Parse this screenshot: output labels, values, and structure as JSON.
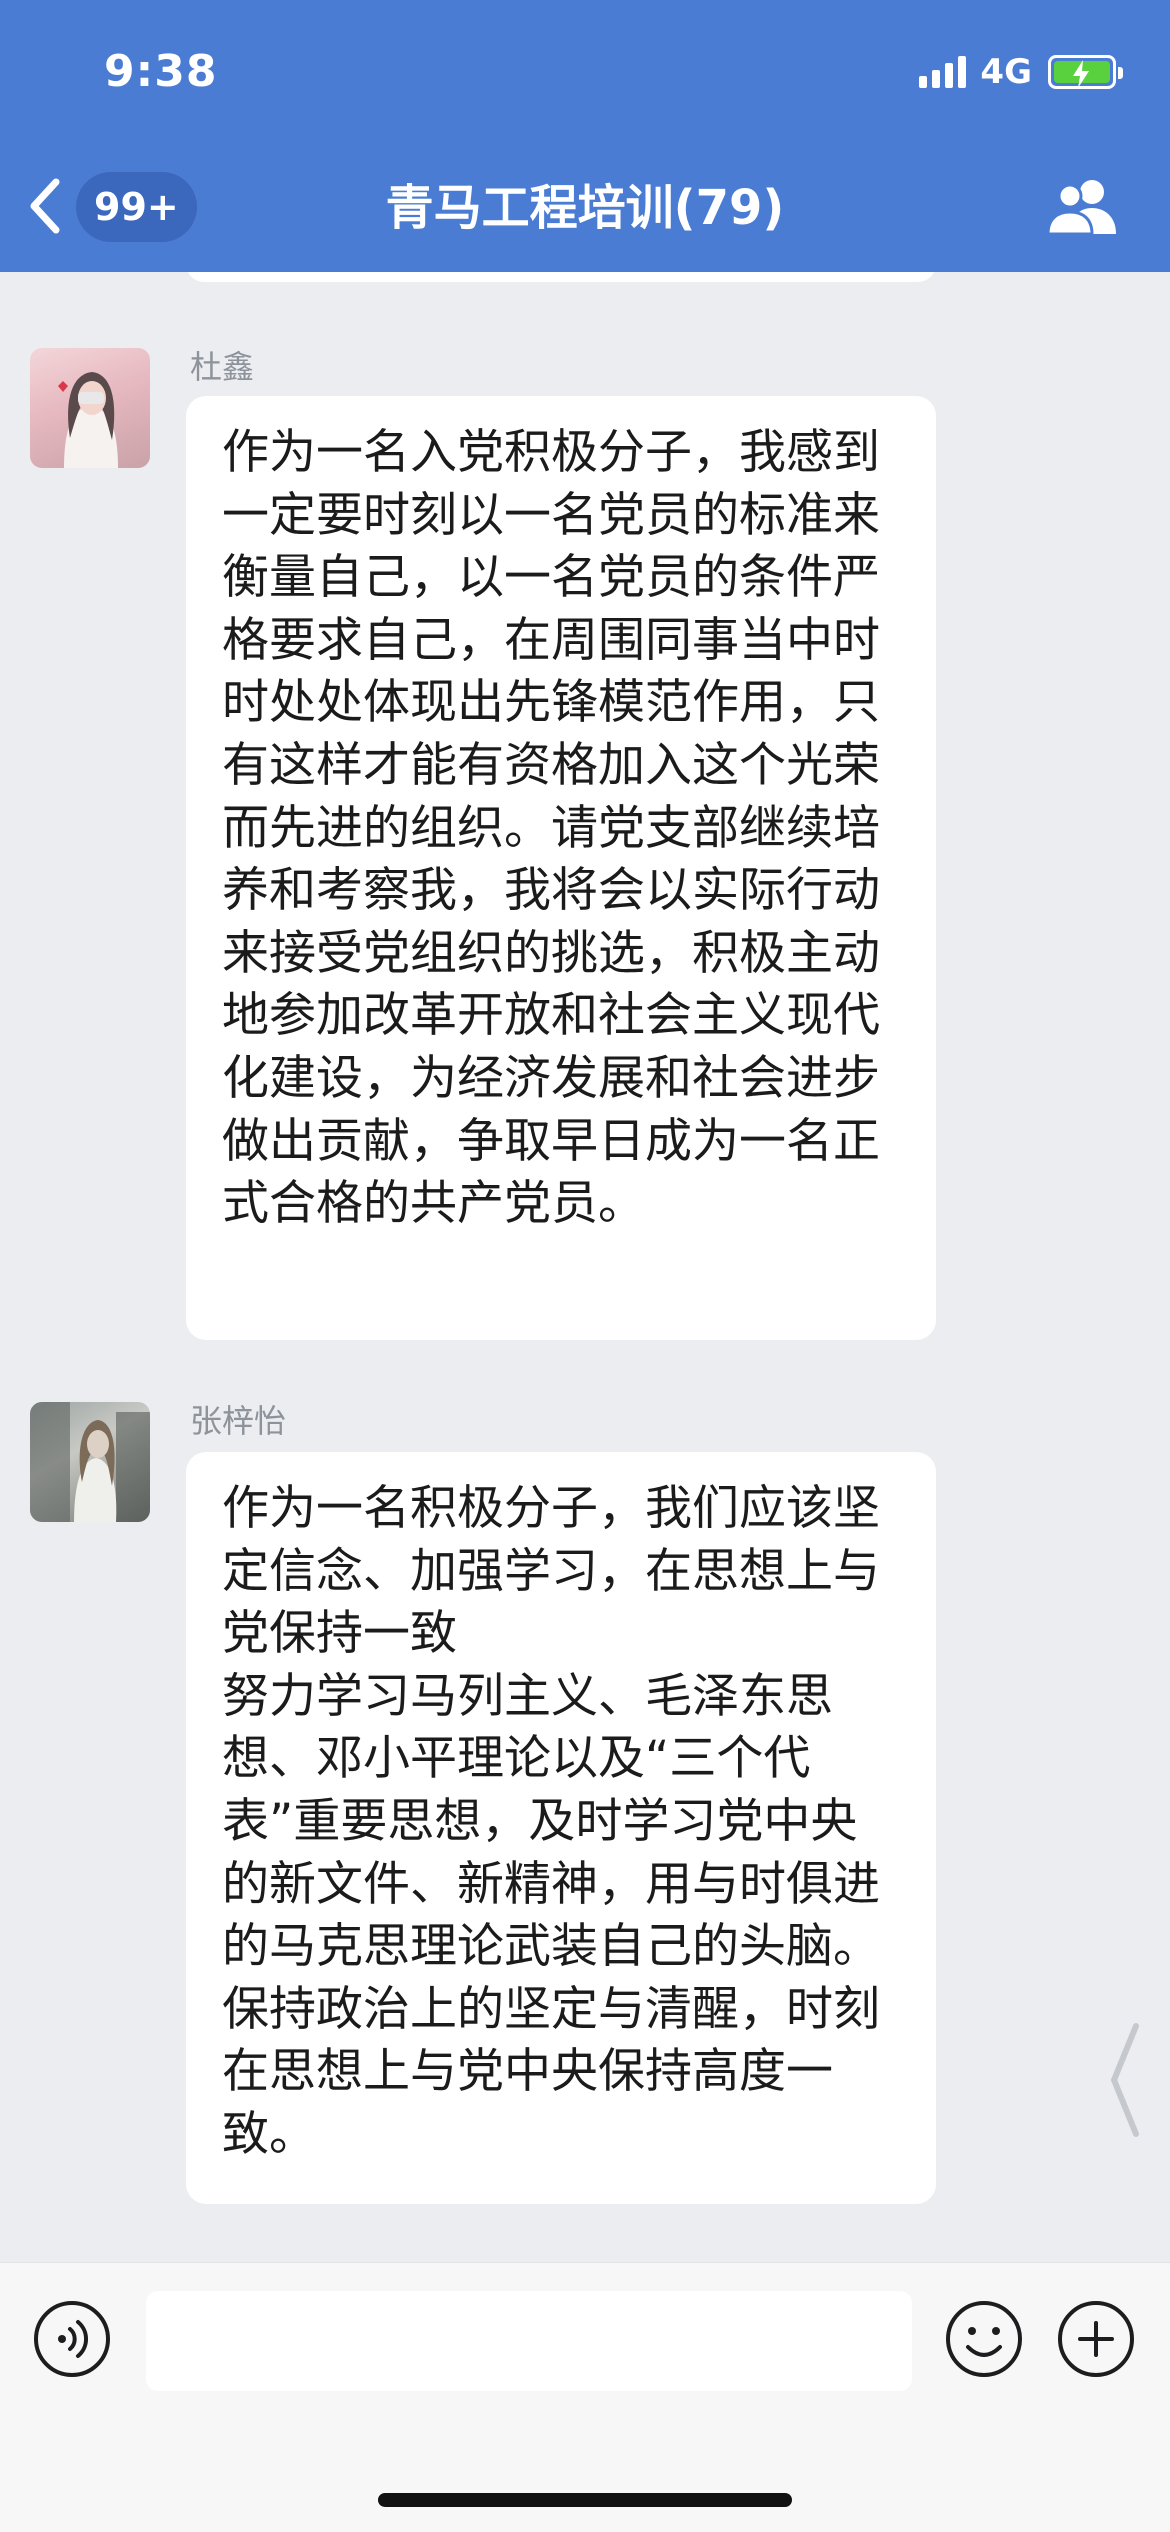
{
  "status_bar": {
    "time": "9:38",
    "network": "4G",
    "battery_state": "charging"
  },
  "nav": {
    "back_icon": "chevron-left-icon",
    "unread_count": "99+",
    "title": "青马工程培训(79)",
    "members_icon": "group-members-icon"
  },
  "messages": [
    {
      "sender": "杜鑫",
      "avatar": "avatar-girl-pink",
      "text": "作为一名入党积极分子，我感到一定要时刻以一名党员的标准来衡量自己，以一名党员的条件严格要求自己，在周围同事当中时时处处体现出先锋模范作用，只有这样才能有资格加入这个光荣而先进的组织。请党支部继续培养和考察我，我将会以实际行动来接受党组织的挑选，积极主动地参加改革开放和社会主义现代化建设，为经济发展和社会进步做出贡献，争取早日成为一名正式合格的共产党员。"
    },
    {
      "sender": "张梓怡",
      "avatar": "avatar-street-photo",
      "text": "作为一名积极分子，我们应该坚定信念、加强学习，在思想上与党保持一致\n努力学习马列主义、毛泽东思想、邓小平理论以及“三个代表”重要思想，及时学习党中央的新文件、新精神，用与时俱进的马克思理论武装自己的头脑。保持政治上的坚定与清醒，时刻在思想上与党中央保持高度一致。"
    }
  ],
  "input_bar": {
    "voice_icon": "voice-input-icon",
    "message_value": "",
    "emoji_icon": "emoji-icon",
    "plus_icon": "plus-circle-icon"
  },
  "colors": {
    "header_bg": "#4a7cd3",
    "chat_bg": "#ebedf0",
    "bubble_bg": "#ffffff",
    "battery_fill": "#59d13f"
  }
}
